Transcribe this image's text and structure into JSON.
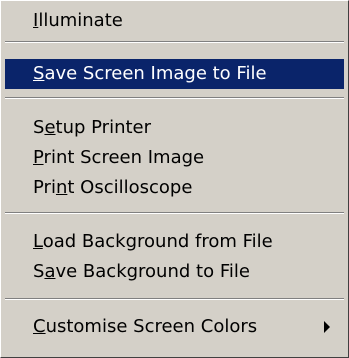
{
  "menu": {
    "items": [
      {
        "before": "",
        "mnemonic": "I",
        "after": "lluminate",
        "selected": false
      },
      {
        "before": "",
        "mnemonic": "S",
        "after": "ave Screen Image to File",
        "selected": true
      },
      {
        "before": "S",
        "mnemonic": "e",
        "after": "tup Printer",
        "selected": false
      },
      {
        "before": "",
        "mnemonic": "P",
        "after": "rint Screen Image",
        "selected": false
      },
      {
        "before": "Pri",
        "mnemonic": "n",
        "after": "t Oscilloscope",
        "selected": false
      },
      {
        "before": "",
        "mnemonic": "L",
        "after": "oad Background from File",
        "selected": false
      },
      {
        "before": "S",
        "mnemonic": "a",
        "after": "ve Background to File",
        "selected": false
      },
      {
        "before": "",
        "mnemonic": "C",
        "after": "ustomise Screen Colors",
        "selected": false,
        "has_submenu": true
      }
    ],
    "highlight_color": "#0a246a",
    "submenu_icon": "triangle-right-icon"
  }
}
